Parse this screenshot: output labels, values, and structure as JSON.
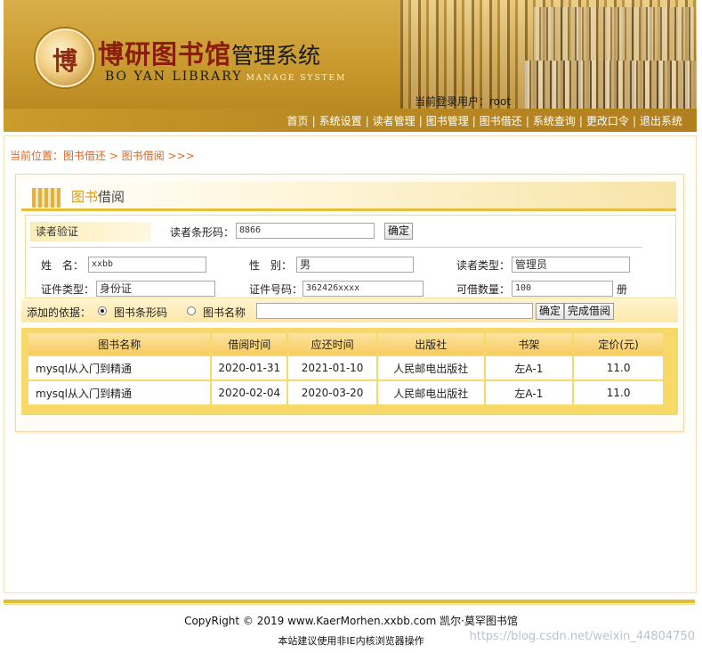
{
  "header": {
    "seal_char": "博",
    "title_cn_a": "博研图书馆",
    "title_cn_b": "管理系统",
    "title_en_a": "BO YAN LIBRARY",
    "title_en_b": "MANAGE SYSTEM",
    "current_user": "当前登录用户：root"
  },
  "nav": {
    "items": [
      "首页",
      "系统设置",
      "读者管理",
      "图书管理",
      "图书借还",
      "系统查询",
      "更改口令",
      "退出系统"
    ],
    "separator": "|"
  },
  "breadcrumb": {
    "prefix": "当前位置：",
    "crumb1": "图书借还",
    "arrow": " > ",
    "crumb2": "图书借阅",
    "suffix": " >>>"
  },
  "panel": {
    "title_light": "图书",
    "title_dark": "借阅"
  },
  "reader": {
    "verify_label": "读者验证",
    "barcode_label": "读者条形码：",
    "barcode_value": "8866",
    "confirm_label": "确定",
    "name_label": "姓　名：",
    "name_value": "xxbb",
    "gender_label": "性　别：",
    "gender_value": "男",
    "type_label": "读者类型：",
    "type_value": "管理员",
    "id_type_label": "证件类型：",
    "id_type_value": "身份证",
    "id_no_label": "证件号码：",
    "id_no_value": "362426xxxx",
    "limit_label": "可借数量：",
    "limit_value": "100",
    "limit_unit": "册"
  },
  "basis": {
    "label": "添加的依据：",
    "option_barcode": "图书条形码",
    "option_name": "图书名称",
    "selected": "图书条形码",
    "input_value": "",
    "confirm_label": "确定",
    "finish_label": "完成借阅"
  },
  "table": {
    "headers": [
      "图书名称",
      "借阅时间",
      "应还时间",
      "出版社",
      "书架",
      "定价(元)"
    ],
    "rows": [
      [
        "mysql从入门到精通",
        "2020-01-31",
        "2021-01-10",
        "人民邮电出版社",
        "左A-1",
        "11.0"
      ],
      [
        "mysql从入门到精通",
        "2020-02-04",
        "2020-03-20",
        "人民邮电出版社",
        "左A-1",
        "11.0"
      ]
    ]
  },
  "footer": {
    "copyright": "CopyRight © 2019 www.KaerMorhen.xxbb.com 凯尔·莫罕图书馆",
    "note": "本站建议使用非IE内核浏览器操作",
    "watermark": "https://blog.csdn.net/weixin_44804750"
  },
  "colors": {
    "gold": "#c99a2e",
    "accent_orange": "#e0661b",
    "table_header": "#f7cc62"
  }
}
